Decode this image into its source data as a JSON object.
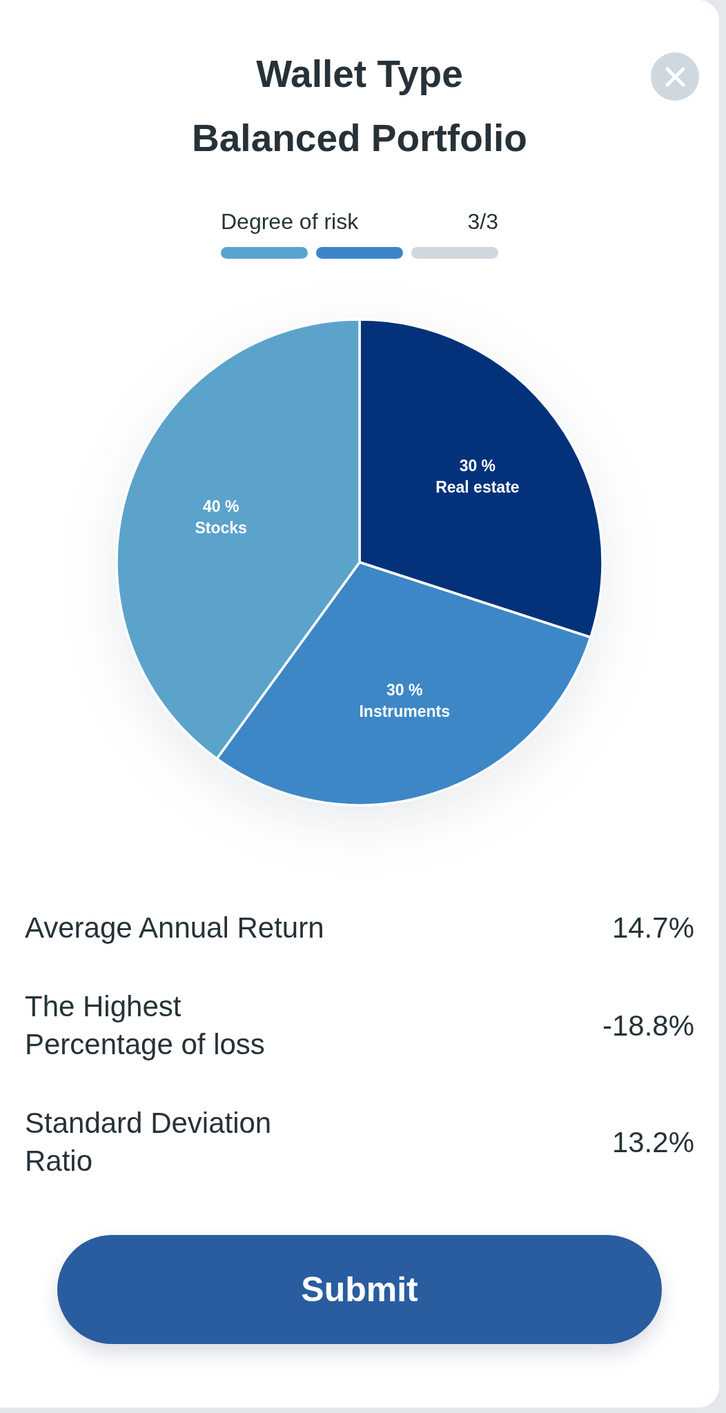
{
  "header": {
    "title": "Wallet Type",
    "subtitle": "Balanced Portfolio"
  },
  "risk": {
    "label": "Degree of risk",
    "count": "3/3",
    "segments": [
      {
        "filled": true,
        "color": "#5ba3cf"
      },
      {
        "filled": true,
        "color": "#3c86c6"
      },
      {
        "filled": false
      }
    ]
  },
  "allocation": {
    "chart_data": {
      "type": "pie",
      "categories": [
        "Real estate",
        "Instruments",
        "Stocks"
      ],
      "values": [
        30,
        30,
        40
      ],
      "value_labels": [
        "30 %",
        "30 %",
        "40 %"
      ],
      "colors": [
        "#03327a",
        "#3d87c6",
        "#5ca3cc"
      ]
    }
  },
  "stats": [
    {
      "label": [
        "Average Annual Return"
      ],
      "value": "14.7%"
    },
    {
      "label": [
        "The Highest",
        "Percentage of loss"
      ],
      "value": "-18.8%"
    },
    {
      "label": [
        "Standard Deviation",
        "Ratio"
      ],
      "value": "13.2%"
    }
  ],
  "submit_button": {
    "label": "Submit"
  }
}
